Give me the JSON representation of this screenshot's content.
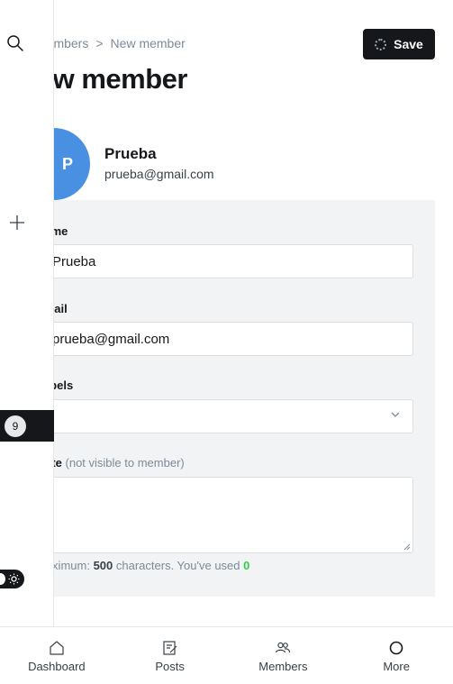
{
  "breadcrumb": {
    "parent": "Members",
    "current": "New member"
  },
  "header": {
    "title": "New member",
    "save_label": "Save"
  },
  "member": {
    "initial": "P",
    "name": "Prueba",
    "email": "prueba@gmail.com"
  },
  "form": {
    "name_label": "Name",
    "name_value": "Prueba",
    "email_label": "Email",
    "email_value": "prueba@gmail.com",
    "labels_label": "Labels",
    "note_label": "Note",
    "note_hint": "(not visible to member)",
    "limit_prefix": "Maximum: ",
    "limit_max": "500",
    "limit_middle": " characters. You've used ",
    "limit_used": "0"
  },
  "sidebar": {
    "notification_count": "9"
  },
  "tabbar": {
    "items": [
      {
        "label": "Dashboard",
        "icon": "home-icon"
      },
      {
        "label": "Posts",
        "icon": "posts-icon"
      },
      {
        "label": "Members",
        "icon": "members-icon"
      },
      {
        "label": "More",
        "icon": "more-icon"
      }
    ]
  },
  "colors": {
    "avatar": "#4a90e2",
    "accent_green": "#30cf43",
    "dark": "#15171a",
    "panel": "#f1f3f4"
  }
}
